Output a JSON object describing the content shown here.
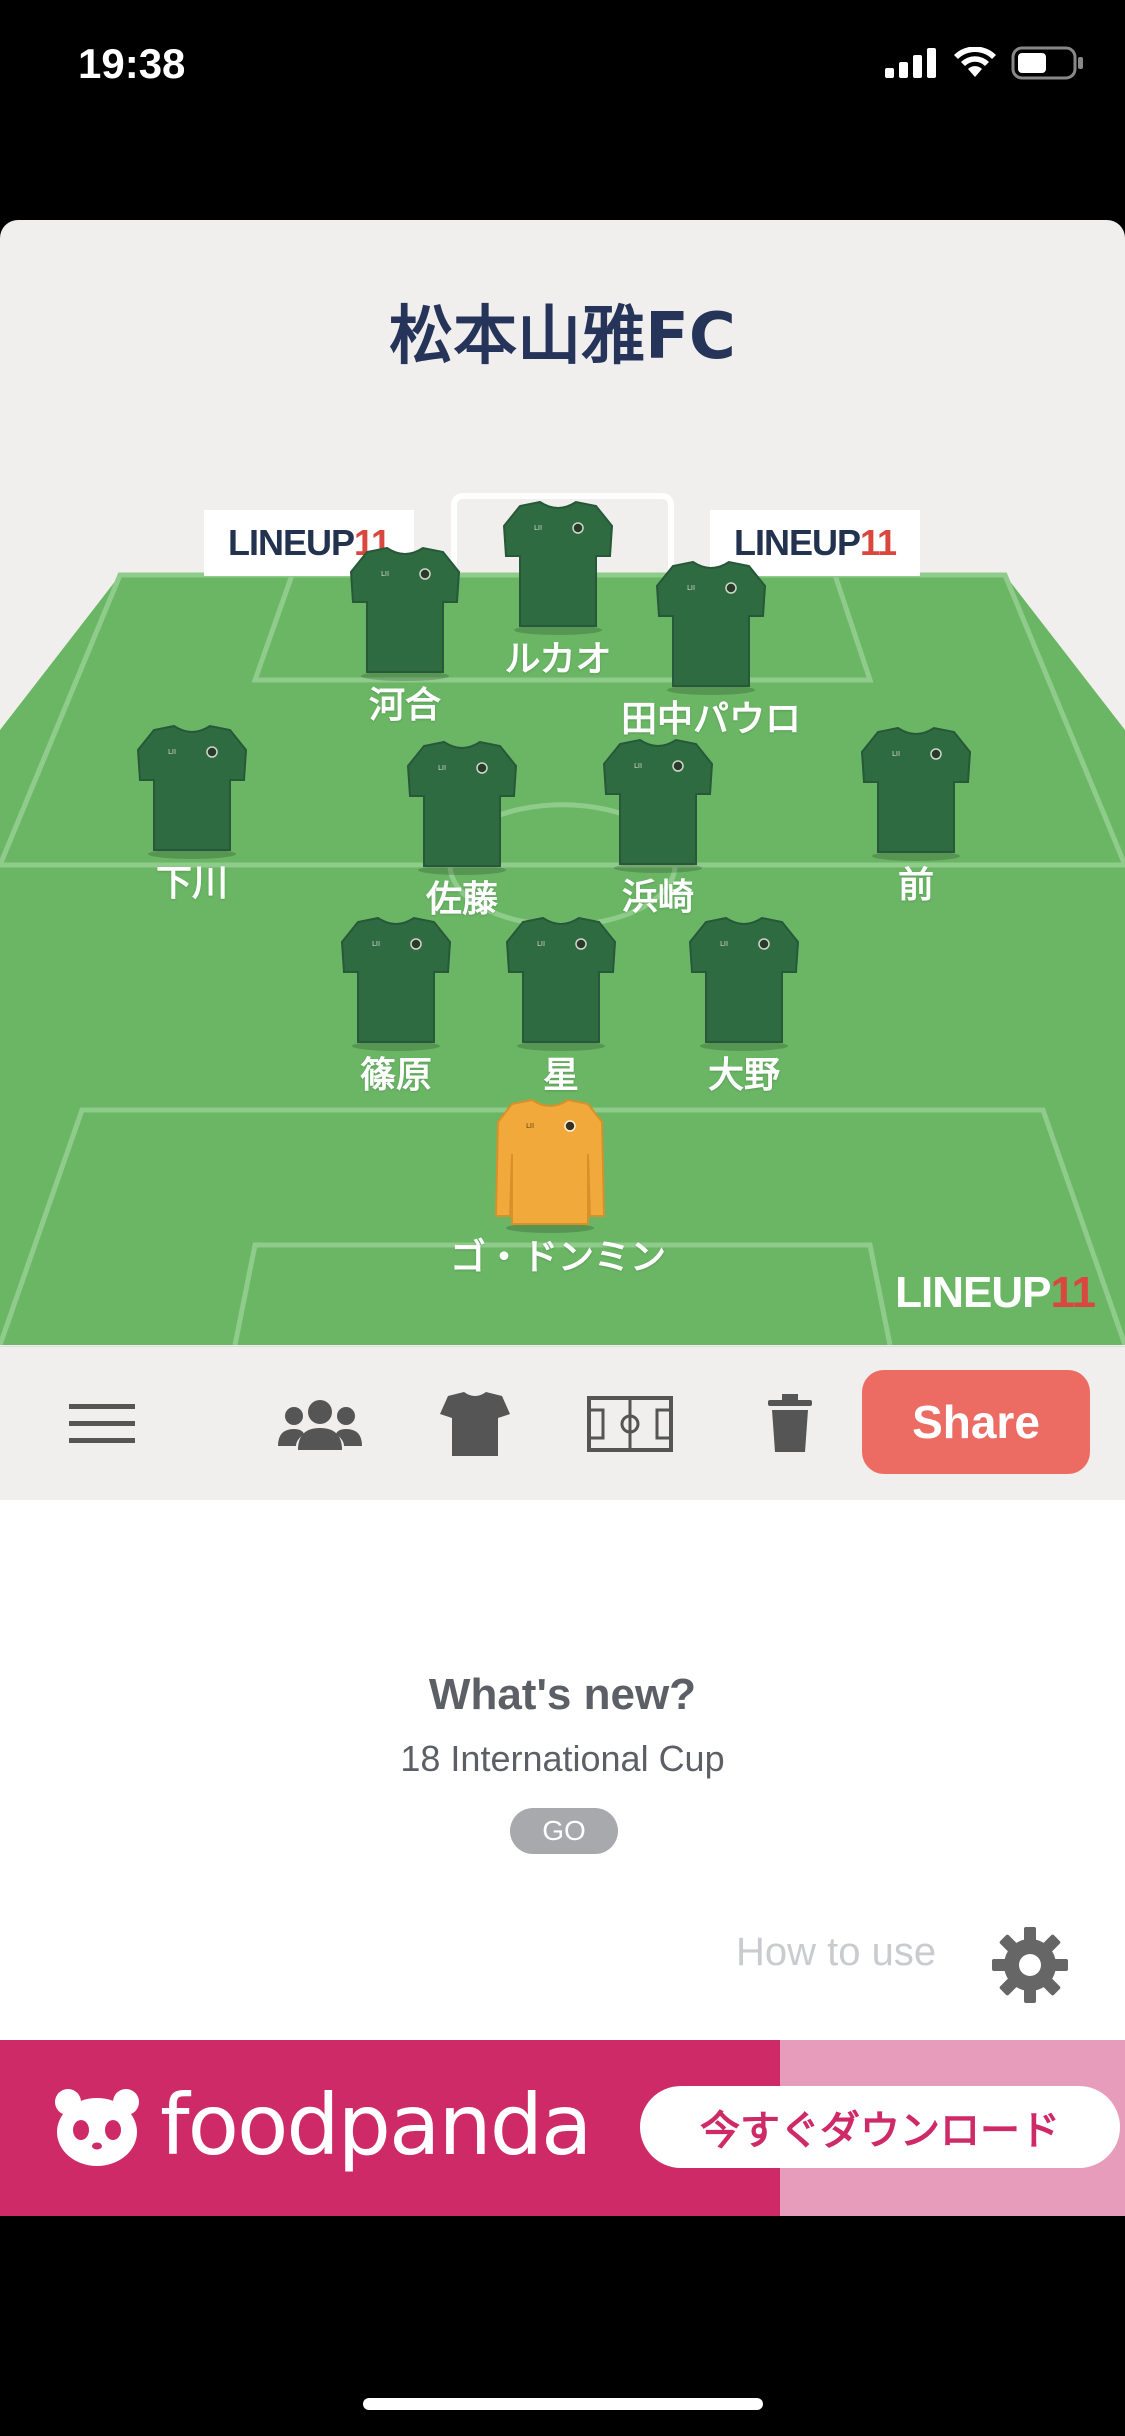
{
  "status": {
    "time": "19:38"
  },
  "team": {
    "name": "松本山雅FC"
  },
  "sponsor": {
    "prefix": "LINEUP",
    "suffix": "11"
  },
  "players": [
    {
      "name": "河合",
      "kit": "outfield"
    },
    {
      "name": "ルカオ",
      "kit": "outfield"
    },
    {
      "name": "田中パウロ",
      "kit": "outfield"
    },
    {
      "name": "下川",
      "kit": "outfield"
    },
    {
      "name": "佐藤",
      "kit": "outfield"
    },
    {
      "name": "浜崎",
      "kit": "outfield"
    },
    {
      "name": "前",
      "kit": "outfield"
    },
    {
      "name": "篠原",
      "kit": "outfield"
    },
    {
      "name": "星",
      "kit": "outfield"
    },
    {
      "name": "大野",
      "kit": "outfield"
    },
    {
      "name": "ゴ・ドンミン",
      "kit": "goalkeeper"
    }
  ],
  "colors": {
    "pitch": "#6ab665",
    "outfield_kit": "#2f6b40",
    "gk_kit": "#f2a93b",
    "share": "#ec6c63",
    "title": "#26345a"
  },
  "toolbar": {
    "icons": [
      "menu-icon",
      "players-icon",
      "shirt-icon",
      "pitch-icon",
      "trash-icon"
    ],
    "share_label": "Share"
  },
  "whats_new": {
    "title": "What's new?",
    "subtitle": "18 International Cup",
    "go_label": "GO"
  },
  "help": {
    "how_to_use": "How to use"
  },
  "ad": {
    "brand": "foodpanda",
    "cta": "今すぐダウンロード"
  }
}
